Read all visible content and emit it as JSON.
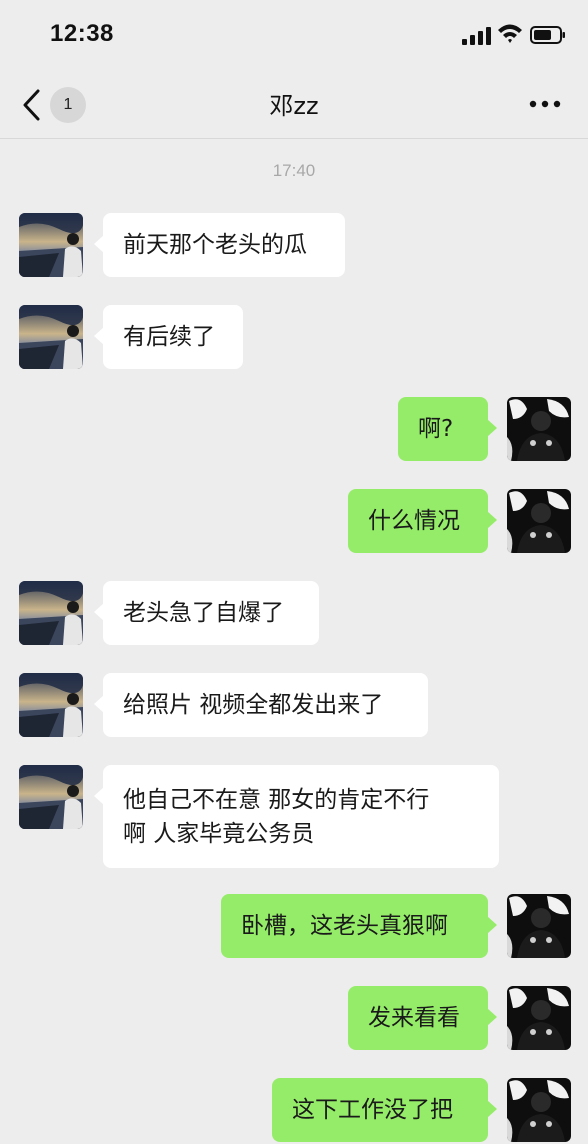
{
  "status_bar": {
    "time": "12:38",
    "icons": [
      "signal-icon",
      "wifi-icon",
      "battery-icon"
    ]
  },
  "header": {
    "back_icon": "chevron-left-icon",
    "unread_count": "1",
    "title": "邓zz",
    "more_icon": "more-horizontal-icon"
  },
  "chat": {
    "timestamp": "17:40",
    "messages": [
      {
        "side": "in",
        "text": "前天那个老头的瓜"
      },
      {
        "side": "in",
        "text": "有后续了"
      },
      {
        "side": "out",
        "text": "啊?"
      },
      {
        "side": "out",
        "text": "什么情况"
      },
      {
        "side": "in",
        "text": "老头急了自爆了"
      },
      {
        "side": "in",
        "text": "给照片 视频全都发出来了"
      },
      {
        "side": "in",
        "lines": [
          "他自己不在意 那女的肯定不行",
          "啊 人家毕竟公务员"
        ]
      },
      {
        "side": "out",
        "text": "卧槽，这老头真狠啊"
      },
      {
        "side": "out",
        "text": "发来看看"
      },
      {
        "side": "out",
        "text": "这下工作没了把"
      }
    ]
  },
  "colors": {
    "background": "#ededed",
    "incoming_bubble": "#ffffff",
    "outgoing_bubble": "#95ec69"
  }
}
